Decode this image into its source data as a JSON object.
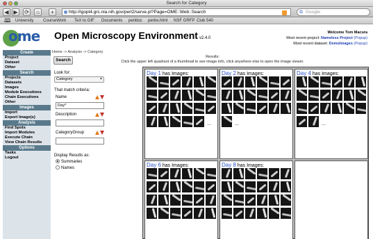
{
  "browser": {
    "window_title": "Search for Category",
    "url": "http://lgopt4.grc.nia.nih.gov/perl2/serve.pl?Page=OME::Web::Search",
    "search_placeholder": "Google",
    "search_glyph": "G",
    "nav": [
      "◀",
      "▶",
      "⟳",
      "⌂",
      "+"
    ],
    "bookmarks": [
      "University",
      "CourseWork",
      "TeX to GIF",
      "Documents",
      "perldoc",
      "perlre.html",
      "NSF GRFP",
      "Club 540"
    ]
  },
  "header": {
    "logo_text": "ome",
    "title": "Open Microscopy Environment",
    "version": "v2.4.0",
    "welcome": "Welcome Tom Macura",
    "recent_project_label": "Most recent project:",
    "recent_project": "Nameless Project",
    "recent_dataset_label": "Most recent dataset:",
    "recent_dataset": "DemoImages",
    "popup": "(Popup)"
  },
  "breadcrumb": "Home -> Analysis -> Category",
  "results_header": {
    "title": "Results:",
    "hint": "Click the upper left quadrant of a thumbnail to see image info, click anywhere else to open the image viewer."
  },
  "sidebar": {
    "sections": [
      {
        "title": "Create",
        "items": [
          "Project",
          "Dataset",
          "Other"
        ]
      },
      {
        "title": "Search",
        "items": [
          "Projects",
          "Datasets",
          "Images",
          "Module Executions",
          "Chain Executions",
          "Other"
        ]
      },
      {
        "title": "Images",
        "items": [
          "Import",
          "Export Image(s)"
        ]
      },
      {
        "title": "Analysis",
        "items": [
          "Find Spots",
          "Import Modules",
          "Execute Chain",
          "View Chain Results"
        ]
      },
      {
        "title": "Options",
        "items": [
          "Tasks",
          "Logout"
        ]
      }
    ]
  },
  "form": {
    "search_button": "Search",
    "look_for_label": "Look for:",
    "look_for_value": "Category",
    "criteria_label": "That match criteria:",
    "name_label": "Name",
    "name_value": "Day*",
    "description_label": "Description",
    "description_value": "",
    "category_group_label": "CategoryGroup",
    "category_group_value": "",
    "display_label": "Display Results as:",
    "option_summaries": "Summaries",
    "option_names": "Names",
    "selected_option": "Summaries"
  },
  "results": [
    {
      "day": "Day 1",
      "suffix": " has Images:",
      "thumb_count": 23,
      "more": "..."
    },
    {
      "day": "Day 2",
      "suffix": " has Images:",
      "thumb_count": 19,
      "more": "..."
    },
    {
      "day": "Day 4",
      "suffix": " has Images:",
      "thumb_count": 20,
      "more": "..."
    },
    {
      "day": "Day 6",
      "suffix": " has Images:",
      "thumb_count": 24,
      "more": ""
    },
    {
      "day": "Day 8",
      "suffix": " has Images:",
      "thumb_count": 24,
      "more": ""
    }
  ],
  "colors": {
    "title_blue": "#2b50c8",
    "sidebar_head": "#5a7a8c",
    "sidebar_bg": "#dce4ea",
    "link_blue": "#1d3fb3"
  }
}
